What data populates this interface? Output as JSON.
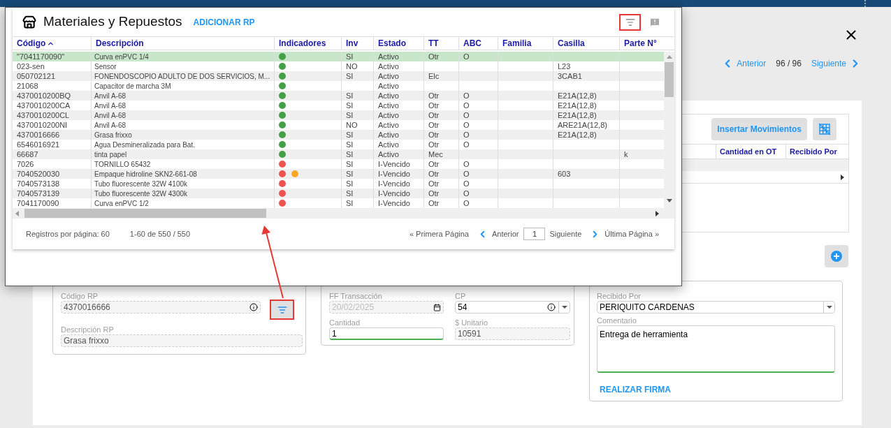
{
  "record_nav": {
    "previous": "Anterior",
    "position": "96 / 96",
    "next": "Siguiente"
  },
  "movements_card": {
    "insert_button": "Insertar Movimientos",
    "columns": [
      "Cantidad en OT",
      "Recibido Por"
    ]
  },
  "form": {
    "codigo_rp": {
      "label": "Código RP",
      "value": "4370016666",
      "disabled": true
    },
    "search_button": {
      "highlighted": true
    },
    "descripcion_rp": {
      "label": "Descripción RP",
      "value": "Grasa frixxo",
      "disabled": true
    },
    "ff_transaccion": {
      "label": "FF Transacción",
      "value": "20/02/2025",
      "disabled": true
    },
    "cp": {
      "label": "CP",
      "value": "54",
      "disabled": false
    },
    "cantidad": {
      "label": "Cantidad",
      "value": "1",
      "disabled": false,
      "valid": true
    },
    "unitario": {
      "label": "$ Unitario",
      "value": "10591",
      "disabled": true
    },
    "recibido_por": {
      "label": "Recibido Por",
      "value": "PERIQUITO CARDENAS"
    },
    "comentario": {
      "label": "Comentario",
      "value": "Entrega de herramienta",
      "valid": true
    },
    "sign_link": "REALIZAR FIRMA"
  },
  "dialog": {
    "title": "Materiales y Repuestos",
    "add_link": "ADICIONAR RP",
    "filter_button": {
      "highlighted": true
    },
    "columns": [
      {
        "label": "Código",
        "sorted": true
      },
      {
        "label": "Descripción",
        "sorted": false
      },
      {
        "label": "Indicadores",
        "sorted": false
      },
      {
        "label": "Inv",
        "sorted": false
      },
      {
        "label": "Estado",
        "sorted": false
      },
      {
        "label": "TT",
        "sorted": false
      },
      {
        "label": "ABC",
        "sorted": false
      },
      {
        "label": "Familia",
        "sorted": false
      },
      {
        "label": "Casilla",
        "sorted": false
      },
      {
        "label": "Parte N°",
        "sorted": false
      }
    ],
    "rows": [
      {
        "codigo": "\"7041170090\"",
        "descripcion": "Curva enPVC 1/4",
        "indicators": [
          {
            "color": "#43a047"
          }
        ],
        "inv": "SI",
        "estado": "Activo",
        "tt": "Otr",
        "abc": "O",
        "selected": true
      },
      {
        "codigo": "023-sen",
        "descripcion": "Sensor",
        "indicators": [
          {
            "color": "#43a047"
          }
        ],
        "inv": "NO",
        "estado": "Activo",
        "casilla": "L23",
        "selected": false
      },
      {
        "codigo": "050702121",
        "descripcion": "FONENDOSCOPIO ADULTO DE DOS SERVICIOS, M...",
        "indicators": [
          {
            "color": "#43a047"
          }
        ],
        "inv": "SI",
        "estado": "Activo",
        "tt": "Elc",
        "casilla": "3CAB1",
        "selected": false
      },
      {
        "codigo": "21068",
        "descripcion": "Capacitor de marcha 3M",
        "indicators": [
          {
            "color": "#43a047"
          }
        ],
        "estado": "Activo",
        "selected": false
      },
      {
        "codigo": "4370010200BQ",
        "descripcion": "Anvil A-68",
        "indicators": [
          {
            "color": "#43a047"
          }
        ],
        "inv": "SI",
        "estado": "Activo",
        "tt": "Otr",
        "abc": "O",
        "casilla": "E21A(12,8)",
        "selected": false
      },
      {
        "codigo": "4370010200CA",
        "descripcion": "Anvil A-68",
        "indicators": [
          {
            "color": "#43a047"
          }
        ],
        "inv": "SI",
        "estado": "Activo",
        "tt": "Otr",
        "abc": "O",
        "casilla": "E21A(12,8)",
        "selected": false
      },
      {
        "codigo": "4370010200CL",
        "descripcion": "Anvil A-68",
        "indicators": [
          {
            "color": "#43a047"
          }
        ],
        "inv": "SI",
        "estado": "Activo",
        "tt": "Otr",
        "abc": "O",
        "casilla": "E21A(12,8)",
        "selected": false
      },
      {
        "codigo": "4370010200NI",
        "descripcion": "Anvil A-68",
        "indicators": [
          {
            "color": "#43a047"
          }
        ],
        "inv": "NO",
        "estado": "Activo",
        "tt": "Otr",
        "abc": "O",
        "casilla": "ARE21A(12,8)",
        "selected": false
      },
      {
        "codigo": "4370016666",
        "descripcion": "Grasa frixxo",
        "indicators": [
          {
            "color": "#43a047"
          }
        ],
        "inv": "SI",
        "estado": "Activo",
        "tt": "Otr",
        "abc": "O",
        "casilla": "E21A(12,8)",
        "selected": false
      },
      {
        "codigo": "6546016921",
        "descripcion": "Agua Desmineralizada para Bat.",
        "indicators": [
          {
            "color": "#43a047"
          }
        ],
        "inv": "SI",
        "estado": "Activo",
        "tt": "Otr",
        "abc": "O",
        "selected": false
      },
      {
        "codigo": "66687",
        "descripcion": "tinta papel",
        "indicators": [
          {
            "color": "#43a047"
          }
        ],
        "inv": "SI",
        "estado": "Activo",
        "tt": "Mec",
        "parte": "k",
        "selected": false
      },
      {
        "codigo": "7026",
        "descripcion": "TORNILLO 65432",
        "indicators": [
          {
            "color": "#ef5350"
          }
        ],
        "inv": "SI",
        "estado": "I-Vencido",
        "tt": "Otr",
        "abc": "O",
        "selected": false
      },
      {
        "codigo": "7040520030",
        "descripcion": "Empaque hidroline SKN2-661-08",
        "indicators": [
          {
            "color": "#ef5350"
          },
          {
            "color": "#ffa726"
          }
        ],
        "inv": "SI",
        "estado": "I-Vencido",
        "tt": "Otr",
        "abc": "O",
        "casilla": "603",
        "selected": false
      },
      {
        "codigo": "7040573138",
        "descripcion": "Tubo fluorescente 32W 4100k",
        "indicators": [
          {
            "color": "#ef5350"
          }
        ],
        "inv": "SI",
        "estado": "I-Vencido",
        "tt": "Otr",
        "abc": "O",
        "selected": false
      },
      {
        "codigo": "7040573139",
        "descripcion": "Tubo fluorescente 32W 4300k",
        "indicators": [
          {
            "color": "#ef5350"
          }
        ],
        "inv": "SI",
        "estado": "I-Vencido",
        "tt": "Otr",
        "abc": "O",
        "selected": false
      },
      {
        "codigo": "7041170090",
        "descripcion": "Curva enPVC 1/2",
        "indicators": [
          {
            "color": "#ef5350"
          }
        ],
        "inv": "SI",
        "estado": "I-Vencido",
        "tt": "Otr",
        "abc": "O",
        "selected": false
      }
    ],
    "footer": {
      "per_page": "Registros por página: 60",
      "range": "1-60 de 550 / 550",
      "first": "« Primera Página",
      "previous": "Anterior",
      "page": "1",
      "next": "Siguiente",
      "last": "Última Página »"
    }
  }
}
